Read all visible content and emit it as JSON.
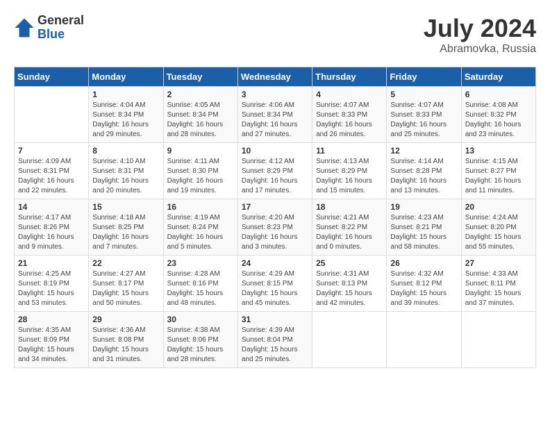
{
  "header": {
    "logo_general": "General",
    "logo_blue": "Blue",
    "title": "July 2024",
    "location": "Abramovka, Russia"
  },
  "weekdays": [
    "Sunday",
    "Monday",
    "Tuesday",
    "Wednesday",
    "Thursday",
    "Friday",
    "Saturday"
  ],
  "weeks": [
    [
      {
        "day": "",
        "info": ""
      },
      {
        "day": "1",
        "info": "Sunrise: 4:04 AM\nSunset: 8:34 PM\nDaylight: 16 hours\nand 29 minutes."
      },
      {
        "day": "2",
        "info": "Sunrise: 4:05 AM\nSunset: 8:34 PM\nDaylight: 16 hours\nand 28 minutes."
      },
      {
        "day": "3",
        "info": "Sunrise: 4:06 AM\nSunset: 8:34 PM\nDaylight: 16 hours\nand 27 minutes."
      },
      {
        "day": "4",
        "info": "Sunrise: 4:07 AM\nSunset: 8:33 PM\nDaylight: 16 hours\nand 26 minutes."
      },
      {
        "day": "5",
        "info": "Sunrise: 4:07 AM\nSunset: 8:33 PM\nDaylight: 16 hours\nand 25 minutes."
      },
      {
        "day": "6",
        "info": "Sunrise: 4:08 AM\nSunset: 8:32 PM\nDaylight: 16 hours\nand 23 minutes."
      }
    ],
    [
      {
        "day": "7",
        "info": "Sunrise: 4:09 AM\nSunset: 8:31 PM\nDaylight: 16 hours\nand 22 minutes."
      },
      {
        "day": "8",
        "info": "Sunrise: 4:10 AM\nSunset: 8:31 PM\nDaylight: 16 hours\nand 20 minutes."
      },
      {
        "day": "9",
        "info": "Sunrise: 4:11 AM\nSunset: 8:30 PM\nDaylight: 16 hours\nand 19 minutes."
      },
      {
        "day": "10",
        "info": "Sunrise: 4:12 AM\nSunset: 8:29 PM\nDaylight: 16 hours\nand 17 minutes."
      },
      {
        "day": "11",
        "info": "Sunrise: 4:13 AM\nSunset: 8:29 PM\nDaylight: 16 hours\nand 15 minutes."
      },
      {
        "day": "12",
        "info": "Sunrise: 4:14 AM\nSunset: 8:28 PM\nDaylight: 16 hours\nand 13 minutes."
      },
      {
        "day": "13",
        "info": "Sunrise: 4:15 AM\nSunset: 8:27 PM\nDaylight: 16 hours\nand 11 minutes."
      }
    ],
    [
      {
        "day": "14",
        "info": "Sunrise: 4:17 AM\nSunset: 8:26 PM\nDaylight: 16 hours\nand 9 minutes."
      },
      {
        "day": "15",
        "info": "Sunrise: 4:18 AM\nSunset: 8:25 PM\nDaylight: 16 hours\nand 7 minutes."
      },
      {
        "day": "16",
        "info": "Sunrise: 4:19 AM\nSunset: 8:24 PM\nDaylight: 16 hours\nand 5 minutes."
      },
      {
        "day": "17",
        "info": "Sunrise: 4:20 AM\nSunset: 8:23 PM\nDaylight: 16 hours\nand 3 minutes."
      },
      {
        "day": "18",
        "info": "Sunrise: 4:21 AM\nSunset: 8:22 PM\nDaylight: 16 hours\nand 0 minutes."
      },
      {
        "day": "19",
        "info": "Sunrise: 4:23 AM\nSunset: 8:21 PM\nDaylight: 15 hours\nand 58 minutes."
      },
      {
        "day": "20",
        "info": "Sunrise: 4:24 AM\nSunset: 8:20 PM\nDaylight: 15 hours\nand 55 minutes."
      }
    ],
    [
      {
        "day": "21",
        "info": "Sunrise: 4:25 AM\nSunset: 8:19 PM\nDaylight: 15 hours\nand 53 minutes."
      },
      {
        "day": "22",
        "info": "Sunrise: 4:27 AM\nSunset: 8:17 PM\nDaylight: 15 hours\nand 50 minutes."
      },
      {
        "day": "23",
        "info": "Sunrise: 4:28 AM\nSunset: 8:16 PM\nDaylight: 15 hours\nand 48 minutes."
      },
      {
        "day": "24",
        "info": "Sunrise: 4:29 AM\nSunset: 8:15 PM\nDaylight: 15 hours\nand 45 minutes."
      },
      {
        "day": "25",
        "info": "Sunrise: 4:31 AM\nSunset: 8:13 PM\nDaylight: 15 hours\nand 42 minutes."
      },
      {
        "day": "26",
        "info": "Sunrise: 4:32 AM\nSunset: 8:12 PM\nDaylight: 15 hours\nand 39 minutes."
      },
      {
        "day": "27",
        "info": "Sunrise: 4:33 AM\nSunset: 8:11 PM\nDaylight: 15 hours\nand 37 minutes."
      }
    ],
    [
      {
        "day": "28",
        "info": "Sunrise: 4:35 AM\nSunset: 8:09 PM\nDaylight: 15 hours\nand 34 minutes."
      },
      {
        "day": "29",
        "info": "Sunrise: 4:36 AM\nSunset: 8:08 PM\nDaylight: 15 hours\nand 31 minutes."
      },
      {
        "day": "30",
        "info": "Sunrise: 4:38 AM\nSunset: 8:06 PM\nDaylight: 15 hours\nand 28 minutes."
      },
      {
        "day": "31",
        "info": "Sunrise: 4:39 AM\nSunset: 8:04 PM\nDaylight: 15 hours\nand 25 minutes."
      },
      {
        "day": "",
        "info": ""
      },
      {
        "day": "",
        "info": ""
      },
      {
        "day": "",
        "info": ""
      }
    ]
  ]
}
